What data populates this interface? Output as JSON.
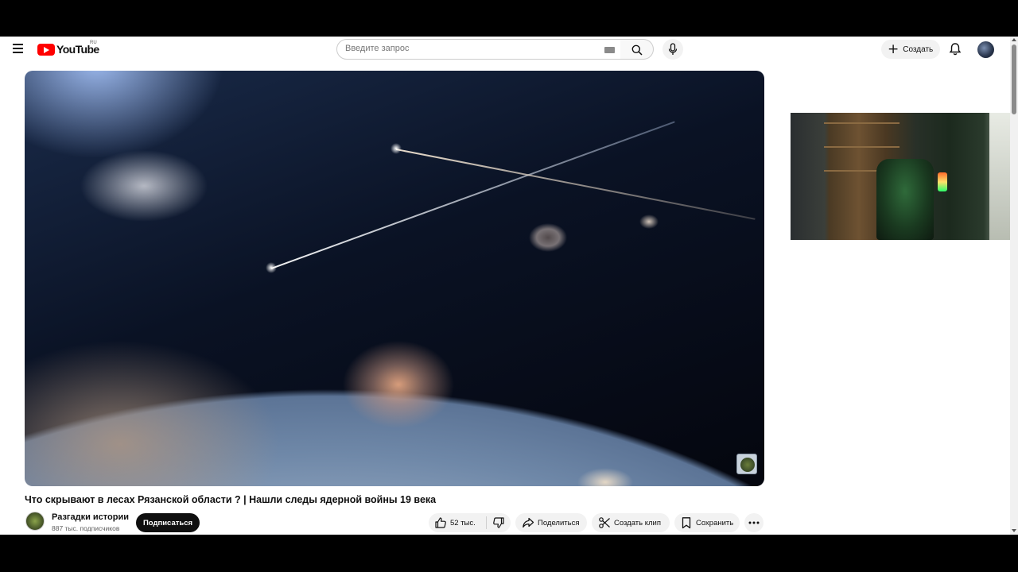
{
  "header": {
    "logo_text": "YouTube",
    "region": "RU",
    "search_placeholder": "Введите запрос",
    "create_label": "Создать",
    "icons": [
      "menu-icon",
      "keyboard-icon",
      "search-icon",
      "mic-icon",
      "plus-icon",
      "bell-icon"
    ]
  },
  "video": {
    "title": "Что скрывают в лесах Рязанской области ? | Нашли следы ядерной войны 19 века"
  },
  "channel": {
    "name": "Разгадки истории",
    "subscribers": "887 тыс. подписчиков",
    "subscribe_label": "Подписаться"
  },
  "actions": {
    "likes": "52 тыс.",
    "share": "Поделиться",
    "clip": "Создать клип",
    "save": "Сохранить"
  },
  "colors": {
    "brand_red": "#ff0000",
    "text_primary": "#0f0f0f",
    "text_secondary": "#606060",
    "pill_bg": "#f2f2f2"
  }
}
